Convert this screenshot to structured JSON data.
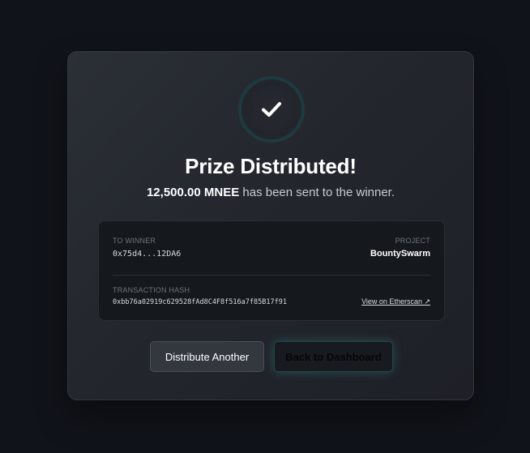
{
  "dialog": {
    "title": "Prize Distributed!",
    "amount": "12,500.00 MNEE",
    "subtitle_rest": " has been sent to the winner.",
    "success_icon": "checkmark-icon"
  },
  "details": {
    "winner_label": "TO WINNER",
    "winner_value": "0x75d4...12DA6",
    "project_label": "PROJECT",
    "project_value": "BountySwarm",
    "tx_label": "TRANSACTION HASH",
    "tx_value": "0xbb76a02919c629528fAd8C4F8f516a7f85B17f91",
    "etherscan_link": "View on Etherscan ↗"
  },
  "actions": {
    "distribute_another": "Distribute Another",
    "back_to_dashboard": "Back to Dashboard"
  },
  "colors": {
    "background": "#101319",
    "modal": "#262a30",
    "details_panel": "#15181d",
    "accent_glow": "#37a0a5"
  }
}
